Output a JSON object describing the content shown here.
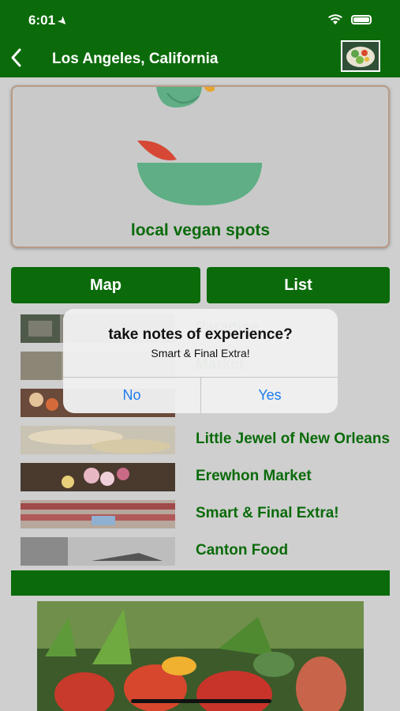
{
  "status_bar": {
    "time": "6:01"
  },
  "header": {
    "title": "Los Angeles, California"
  },
  "hero": {
    "title": "local vegan spots"
  },
  "tabs": {
    "map": "Map",
    "list": "List"
  },
  "places": [
    {
      "name": "Paradise"
    },
    {
      "name": "Market"
    },
    {
      "name": ""
    },
    {
      "name": "Little Jewel of New Orleans"
    },
    {
      "name": "Erewhon Market"
    },
    {
      "name": "Smart & Final Extra!"
    },
    {
      "name": "Canton Food"
    }
  ],
  "alert": {
    "title": "take notes of experience?",
    "message": "Smart & Final Extra!",
    "no": "No",
    "yes": "Yes"
  },
  "colors": {
    "primary": "#0b6b0b",
    "accent": "#1a7cf0",
    "background": "#cfcfcf"
  }
}
